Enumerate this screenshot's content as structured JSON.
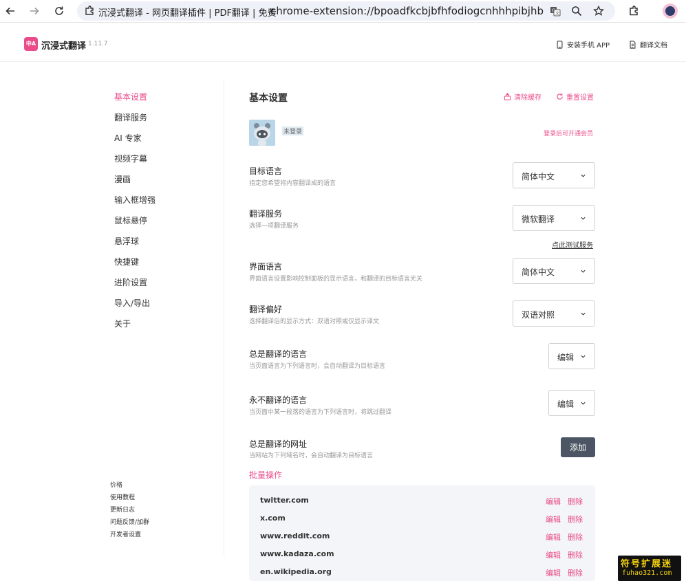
{
  "browser": {
    "tab_title": "沉浸式翻译 - 网页翻译插件 | PDF翻译 | 免费",
    "url": "chrome-extension://bpoadfkcbjbfhfodiogcnhhhpibjhbnh/options.html#general"
  },
  "header": {
    "app_name": "沉浸式翻译",
    "version": "1.11.7",
    "install_app": "安装手机 APP",
    "translate_doc": "翻译文档"
  },
  "sidebar": {
    "items": [
      {
        "label": "基本设置",
        "active": true
      },
      {
        "label": "翻译服务"
      },
      {
        "label": "AI 专家"
      },
      {
        "label": "视频字幕"
      },
      {
        "label": "漫画"
      },
      {
        "label": "输入框增强"
      },
      {
        "label": "鼠标悬停"
      },
      {
        "label": "悬浮球"
      },
      {
        "label": "快捷键"
      },
      {
        "label": "进阶设置"
      },
      {
        "label": "导入/导出"
      },
      {
        "label": "关于"
      }
    ],
    "footer": [
      "价格",
      "使用教程",
      "更新日志",
      "问题反馈/加群",
      "开发者设置"
    ]
  },
  "main": {
    "title": "基本设置",
    "clear_cache": "清除缓存",
    "reset": "重置设置",
    "login_status": "未登录",
    "vip_link": "登录后可开通会员",
    "settings": [
      {
        "title": "目标语言",
        "desc": "指定您希望将内容翻译成的语言",
        "value": "简体中文"
      },
      {
        "title": "翻译服务",
        "desc": "选择一项翻译服务",
        "value": "微软翻译"
      },
      {
        "title": "界面语言",
        "desc": "界面语言设置影响控制面板的显示语言，和翻译的目标语言无关",
        "value": "简体中文"
      },
      {
        "title": "翻译偏好",
        "desc": "选择翻译后的显示方式：双语对照或仅显示译文",
        "value": "双语对照"
      },
      {
        "title": "总是翻译的语言",
        "desc": "当页面语言为下列语言时，会自动翻译为目标语言",
        "value": "编辑"
      },
      {
        "title": "永不翻译的语言",
        "desc": "当页面中某一段落的语言为下列语言时，将跳过翻译",
        "value": "编辑"
      },
      {
        "title": "总是翻译的网址",
        "desc": "当网站为下列域名时，会自动翻译为目标语言",
        "value": "添加"
      }
    ],
    "test_service": "点此测试服务",
    "bulk_ops": "批量操作",
    "url_edit_label": "编辑",
    "url_delete_label": "删除",
    "urls": [
      "twitter.com",
      "x.com",
      "www.reddit.com",
      "www.kadaza.com",
      "en.wikipedia.org"
    ]
  },
  "watermark": {
    "line1": "符号扩展迷",
    "line2": "fuhao321.com"
  },
  "colors": {
    "accent": "#ea4c89",
    "button_dark": "#4b5563",
    "panel_bg": "#f3f5f8"
  }
}
